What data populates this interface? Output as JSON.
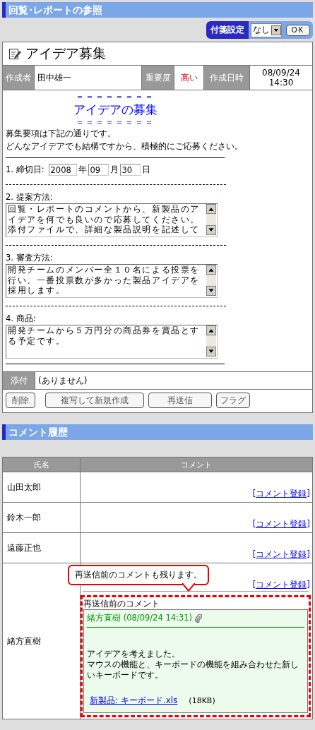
{
  "page_title": "回覧･レポートの参照",
  "sticky": {
    "label": "付箋設定",
    "value": "なし",
    "ok": "OK"
  },
  "report": {
    "title": "アイデア募集",
    "meta": [
      {
        "label": "作成者",
        "value": "田中雄一",
        "kind": "plain"
      },
      {
        "label": "重要度",
        "value": "高い",
        "kind": "alert"
      },
      {
        "label": "作成日時",
        "value": "08/09/24 14:30",
        "kind": "date"
      }
    ],
    "body": {
      "rule_top": "＝＝＝＝＝＝＝＝",
      "heading": "アイデアの募集",
      "rule_bottom": "＝＝＝＝＝＝＝＝",
      "intro": [
        "募集要項は下記の通りです。",
        "どんなアイデアでも結構ですから、積極的にご応募ください。"
      ],
      "deadline": {
        "label": "1. 締切日:",
        "year": "2008",
        "year_unit": "年",
        "month": "09",
        "month_unit": "月",
        "day": "30",
        "day_unit": "日"
      },
      "sections": [
        {
          "label": "2. 提案方法:",
          "lines": [
            "回覧・レポートのコメントから、新製品のア",
            "イデアを何でも良いので応募してください。",
            "添付ファイルで、詳細な製品説明を記述して"
          ]
        },
        {
          "label": "3. 審査方法:",
          "lines": [
            "開発チームのメンバー全１０名による投票を",
            "行い、一番投票数が多かった製品アイデアを",
            "採用します。"
          ]
        },
        {
          "label": "4. 商品:",
          "lines": [
            "開発チームから５万円分の商品券を賞品とす",
            "る予定です。"
          ]
        }
      ]
    },
    "attachment": {
      "label": "添付",
      "value": "(ありません)"
    },
    "buttons": [
      "削除",
      "複写して新規作成",
      "再送信",
      "フラグ"
    ]
  },
  "comments": {
    "title": "コメント履歴",
    "columns": [
      "氏名",
      "コメント"
    ],
    "rows": [
      {
        "name": "山田太郎",
        "link": "[コメント登録]"
      },
      {
        "name": "鈴木一郎",
        "link": "[コメント登録]"
      },
      {
        "name": "遠藤正也",
        "link": "[コメント登録]"
      },
      {
        "name": "緒方直樹",
        "link": "[コメント登録]",
        "callout": "再送信前のコメントも残ります。",
        "previous": {
          "caption": "再送信前のコメント",
          "header": "緒方直樹 (08/09/24 14:31)",
          "text": [
            "アイデアを考えました。",
            "マウスの機能と、キーボードの機能を組み合わせた新しいキーボードです。"
          ],
          "file": "新製品: キーボード.xls",
          "size": "(18KB)"
        }
      }
    ]
  }
}
